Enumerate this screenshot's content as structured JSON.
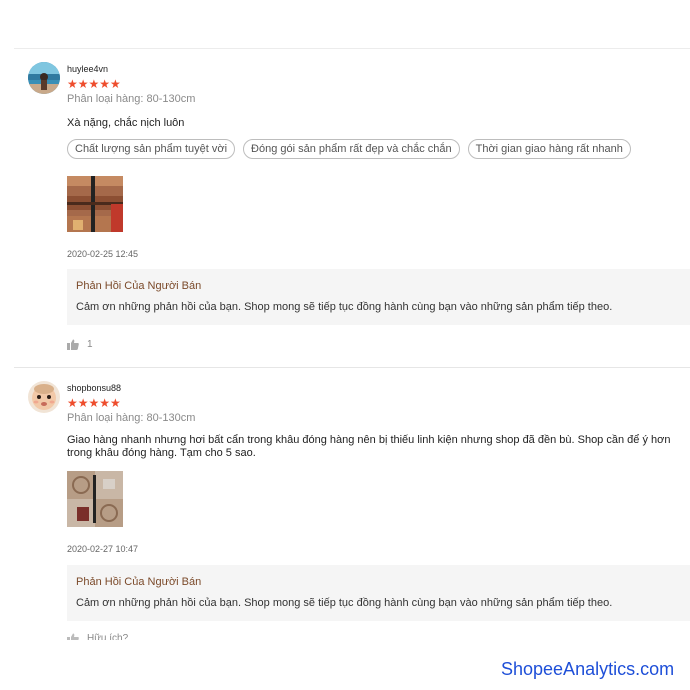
{
  "reviews": [
    {
      "username": "huylee4vn",
      "stars": "★★★★★",
      "rating": 5,
      "variation": "Phân loại hàng: 80-130cm",
      "comment": "Xà nặng, chắc nịch luôn",
      "tags": [
        "Chất lượng sản phẩm tuyệt vời",
        "Đóng gói sản phẩm rất đẹp và chắc chắn",
        "Thời gian giao hàng rất nhanh"
      ],
      "timestamp": "2020-02-25 12:45",
      "seller_reply": {
        "title": "Phản Hồi Của Người Bán",
        "text": "Cảm ơn những phản hồi của bạn. Shop mong sẽ tiếp tục đồng hành cùng bạn vào những sản phẩm tiếp theo."
      },
      "likes": "1",
      "icons": {
        "like": "thumbs-up-icon"
      }
    },
    {
      "username": "shopbonsu88",
      "stars": "★★★★★",
      "rating": 5,
      "variation": "Phân loại hàng: 80-130cm",
      "comment": "Giao hàng nhanh nhưng hơi bất cẩn trong khâu đóng hàng nên bị thiếu linh kiện nhưng shop đã đền bù. Shop cần để ý hơn trong khâu đóng hàng. Tạm cho 5 sao.",
      "timestamp": "2020-02-27 10:47",
      "seller_reply": {
        "title": "Phản Hồi Của Người Bán",
        "text": "Cảm ơn những phản hồi của bạn. Shop mong sẽ tiếp tục đồng hành cùng bạn vào những sản phẩm tiếp theo."
      },
      "likes_label": "Hữu ích?",
      "icons": {
        "like": "thumbs-up-icon"
      }
    }
  ],
  "watermark": "ShopeeAnalytics.com",
  "colors": {
    "star": "#ee4d2d",
    "seller_title": "#7b4a2a",
    "watermark": "#1e4fd8",
    "reply_bg": "#f5f5f5"
  }
}
